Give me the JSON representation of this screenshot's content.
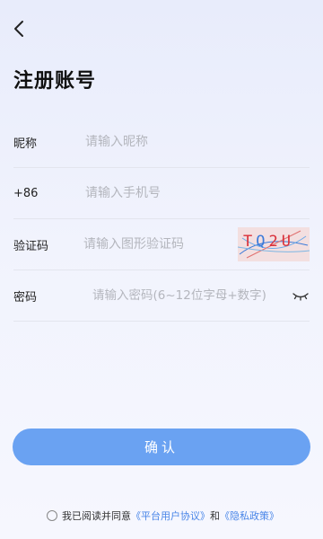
{
  "header": {
    "title": "注册账号"
  },
  "form": {
    "nickname": {
      "label": "昵称",
      "placeholder": "请输入昵称"
    },
    "phone": {
      "label": "+86",
      "placeholder": "请输入手机号"
    },
    "captcha": {
      "label": "验证码",
      "placeholder": "请输入图形验证码",
      "code": "TQ2U"
    },
    "password": {
      "label": "密码",
      "placeholder": "请输入密码(6~12位字母+数字)"
    }
  },
  "confirm_label": "确认",
  "agreement": {
    "prefix": "我已阅读并同意",
    "user_agreement": "《平台用户协议》",
    "and": "和",
    "privacy_policy": "《隐私政策》"
  }
}
